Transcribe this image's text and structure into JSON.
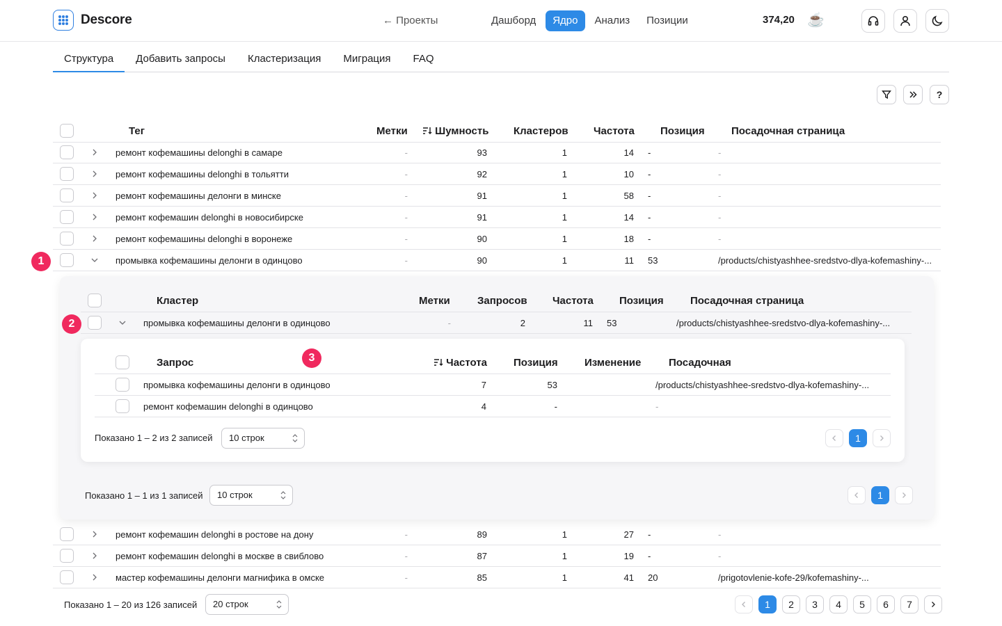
{
  "header": {
    "brand": "Descore",
    "back_label": "← Проекты",
    "nav": [
      {
        "label": "Дашборд",
        "active": false
      },
      {
        "label": "Ядро",
        "active": true
      },
      {
        "label": "Анализ",
        "active": false
      },
      {
        "label": "Позиции",
        "active": false
      }
    ],
    "balance": "374,20",
    "coffee_emoji": "☕"
  },
  "tabs": [
    "Структура",
    "Добавить запросы",
    "Кластеризация",
    "Миграция",
    "FAQ"
  ],
  "active_tab": 0,
  "tags_table": {
    "headers": {
      "tag": "Тег",
      "labels": "Метки",
      "noise": "Шумность",
      "clusters": "Кластеров",
      "freq": "Частота",
      "position": "Позиция",
      "landing": "Посадочная страница"
    },
    "rows_before": [
      {
        "tag": "ремонт кофемашины delonghi в самаре",
        "labels": "-",
        "noise": "93",
        "clusters": "1",
        "freq": "14",
        "position": "-",
        "landing": "-"
      },
      {
        "tag": "ремонт кофемашины delonghi в тольятти",
        "labels": "-",
        "noise": "92",
        "clusters": "1",
        "freq": "10",
        "position": "-",
        "landing": "-"
      },
      {
        "tag": "ремонт кофемашины делонги в минске",
        "labels": "-",
        "noise": "91",
        "clusters": "1",
        "freq": "58",
        "position": "-",
        "landing": "-"
      },
      {
        "tag": "ремонт кофемашин delonghi в новосибирске",
        "labels": "-",
        "noise": "91",
        "clusters": "1",
        "freq": "14",
        "position": "-",
        "landing": "-"
      },
      {
        "tag": "ремонт кофемашины delonghi в воронеже",
        "labels": "-",
        "noise": "90",
        "clusters": "1",
        "freq": "18",
        "position": "-",
        "landing": "-"
      },
      {
        "tag": "промывка кофемашины делонги в одинцово",
        "labels": "-",
        "noise": "90",
        "clusters": "1",
        "freq": "11",
        "position": "53",
        "landing": "/products/chistyashhee-sredstvo-dlya-kofemashiny-..."
      }
    ],
    "rows_after": [
      {
        "tag": "ремонт кофемашин delonghi в ростове на дону",
        "labels": "-",
        "noise": "89",
        "clusters": "1",
        "freq": "27",
        "position": "-",
        "landing": "-"
      },
      {
        "tag": "ремонт кофемашин delonghi в москве в свиблово",
        "labels": "-",
        "noise": "87",
        "clusters": "1",
        "freq": "19",
        "position": "-",
        "landing": "-"
      },
      {
        "tag": "мастер кофемашины делонги магнифика в омске",
        "labels": "-",
        "noise": "85",
        "clusters": "1",
        "freq": "41",
        "position": "20",
        "landing": "/prigotovlenie-kofe-29/kofemashiny-..."
      }
    ],
    "footer": {
      "shown": "Показано 1 – 20 из 126 записей",
      "rows_select": "20 строк",
      "pages": [
        "1",
        "2",
        "3",
        "4",
        "5",
        "6",
        "7"
      ],
      "active_page": "1"
    }
  },
  "clusters_table": {
    "headers": {
      "cluster": "Кластер",
      "labels": "Метки",
      "queries": "Запросов",
      "freq": "Частота",
      "position": "Позиция",
      "landing": "Посадочная страница"
    },
    "row": {
      "cluster": "промывка кофемашины делонги в одинцово",
      "labels": "-",
      "queries": "2",
      "freq": "11",
      "position": "53",
      "landing": "/products/chistyashhee-sredstvo-dlya-kofemashiny-..."
    },
    "footer": {
      "shown": "Показано 1 – 1 из 1 записей",
      "rows_select": "10 строк",
      "page": "1"
    }
  },
  "queries_table": {
    "headers": {
      "query": "Запрос",
      "freq": "Частота",
      "position": "Позиция",
      "change": "Изменение",
      "landing": "Посадочная"
    },
    "rows": [
      {
        "query": "промывка кофемашины делонги в одинцово",
        "freq": "7",
        "position": "53",
        "change": "",
        "landing": "/products/chistyashhee-sredstvo-dlya-kofemashiny-..."
      },
      {
        "query": "ремонт кофемашин delonghi в одинцово",
        "freq": "4",
        "position": "-",
        "change": "",
        "landing": "-"
      }
    ],
    "footer": {
      "shown": "Показано 1 – 2 из 2 записей",
      "rows_select": "10 строк",
      "page": "1"
    }
  },
  "badges": [
    "1",
    "2",
    "3"
  ],
  "colors": {
    "accent": "#2d8ae6",
    "badge": "#f0295e"
  }
}
